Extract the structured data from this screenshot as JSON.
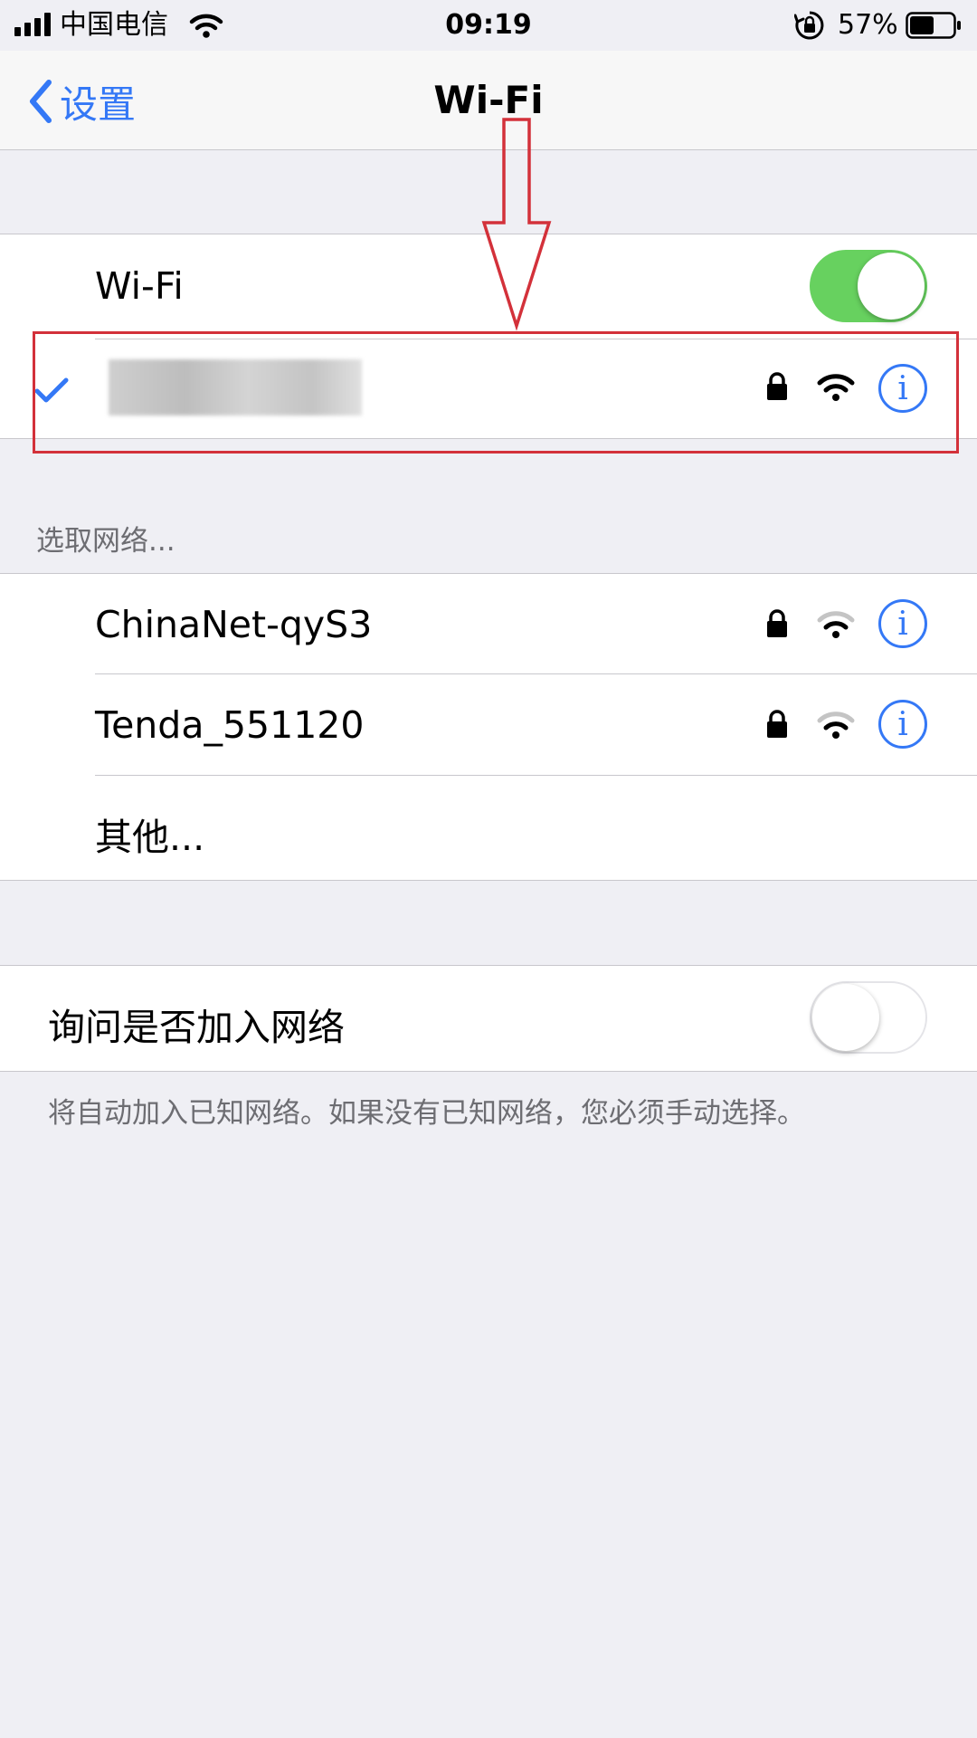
{
  "status_bar": {
    "carrier": "中国电信",
    "time": "09:19",
    "battery_percent": "57%",
    "battery_level": 0.57,
    "icons": [
      "signal-bars-icon",
      "wifi-icon",
      "rotation-lock-icon",
      "battery-icon"
    ]
  },
  "nav": {
    "back_label": "设置",
    "title": "Wi-Fi"
  },
  "wifi_group": {
    "wifi_label": "Wi-Fi",
    "wifi_enabled": true,
    "connected_network": {
      "name_obscured": true,
      "secured": true,
      "signal_bars": 3
    }
  },
  "networks": {
    "header": "选取网络...",
    "items": [
      {
        "name": "ChinaNet-qyS3",
        "secured": true,
        "signal_bars": 2
      },
      {
        "name": "Tenda_551120",
        "secured": true,
        "signal_bars": 2
      }
    ],
    "other_label": "其他..."
  },
  "ask_join": {
    "label": "询问是否加入网络",
    "enabled": false,
    "note": "将自动加入已知网络。如果没有已知网络，您必须手动选择。"
  },
  "colors": {
    "accent": "#3478f6",
    "toggle_on": "#67d15f",
    "annotation": "#d3313a",
    "background": "#efeff4"
  }
}
